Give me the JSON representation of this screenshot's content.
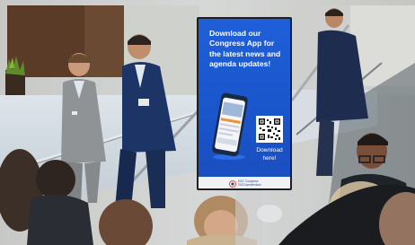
{
  "sign": {
    "headline": "Download our\nCongress App for\nthe latest news and\nagenda updates!",
    "cta": "Download\nhere!",
    "brand": "ESC Congress\n2023 Amsterdam",
    "screen_color": "#1a56cc",
    "qr_icon": "qr-code-icon",
    "phone_icon": "smartphone-icon"
  }
}
